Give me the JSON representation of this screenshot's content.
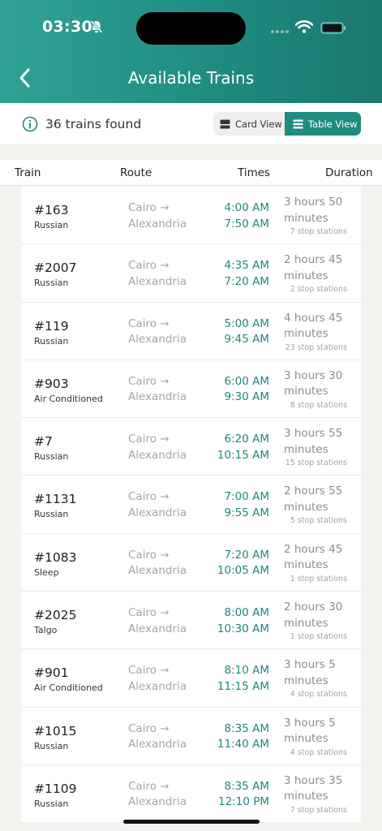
{
  "status_bar": {
    "time": "03:30"
  },
  "header": {
    "title": "Available Trains"
  },
  "summary": {
    "found_text": "36 trains found"
  },
  "view_toggle": {
    "card_label": "Card View",
    "table_label": "Table View",
    "active": "table"
  },
  "table": {
    "headers": {
      "train": "Train",
      "route": "Route",
      "times": "Times",
      "duration": "Duration"
    },
    "rows": [
      {
        "number": "#163",
        "type": "Russian",
        "route_from": "Cairo →",
        "route_to": "Alexandria",
        "depart": "4:00 AM",
        "arrive": "7:50 AM",
        "dur1": "3 hours 50",
        "dur2": "minutes",
        "stops": "7 stop stations"
      },
      {
        "number": "#2007",
        "type": "Russian",
        "route_from": "Cairo →",
        "route_to": "Alexandria",
        "depart": "4:35 AM",
        "arrive": "7:20 AM",
        "dur1": "2 hours 45",
        "dur2": "minutes",
        "stops": "2 stop stations"
      },
      {
        "number": "#119",
        "type": "Russian",
        "route_from": "Cairo →",
        "route_to": "Alexandria",
        "depart": "5:00 AM",
        "arrive": "9:45 AM",
        "dur1": "4 hours 45",
        "dur2": "minutes",
        "stops": "23 stop stations"
      },
      {
        "number": "#903",
        "type": "Air Conditioned",
        "route_from": "Cairo →",
        "route_to": "Alexandria",
        "depart": "6:00 AM",
        "arrive": "9:30 AM",
        "dur1": "3 hours 30",
        "dur2": "minutes",
        "stops": "8 stop stations"
      },
      {
        "number": "#7",
        "type": "Russian",
        "route_from": "Cairo →",
        "route_to": "Alexandria",
        "depart": "6:20 AM",
        "arrive": "10:15 AM",
        "dur1": "3 hours 55",
        "dur2": "minutes",
        "stops": "15 stop stations"
      },
      {
        "number": "#1131",
        "type": "Russian",
        "route_from": "Cairo →",
        "route_to": "Alexandria",
        "depart": "7:00 AM",
        "arrive": "9:55 AM",
        "dur1": "2 hours 55",
        "dur2": "minutes",
        "stops": "5 stop stations"
      },
      {
        "number": "#1083",
        "type": "Sleep",
        "route_from": "Cairo →",
        "route_to": "Alexandria",
        "depart": "7:20 AM",
        "arrive": "10:05 AM",
        "dur1": "2 hours 45",
        "dur2": "minutes",
        "stops": "1 stop stations"
      },
      {
        "number": "#2025",
        "type": "Talgo",
        "route_from": "Cairo →",
        "route_to": "Alexandria",
        "depart": "8:00 AM",
        "arrive": "10:30 AM",
        "dur1": "2 hours 30",
        "dur2": "minutes",
        "stops": "1 stop stations"
      },
      {
        "number": "#901",
        "type": "Air Conditioned",
        "route_from": "Cairo →",
        "route_to": "Alexandria",
        "depart": "8:10 AM",
        "arrive": "11:15 AM",
        "dur1": "3 hours 5",
        "dur2": "minutes",
        "stops": "4 stop stations"
      },
      {
        "number": "#1015",
        "type": "Russian",
        "route_from": "Cairo →",
        "route_to": "Alexandria",
        "depart": "8:35 AM",
        "arrive": "11:40 AM",
        "dur1": "3 hours 5",
        "dur2": "minutes",
        "stops": "4 stop stations"
      },
      {
        "number": "#1109",
        "type": "Russian",
        "route_from": "Cairo →",
        "route_to": "Alexandria",
        "depart": "8:35 AM",
        "arrive": "12:10 PM",
        "dur1": "3 hours 35",
        "dur2": "minutes",
        "stops": "7 stop stations"
      }
    ]
  },
  "colors": {
    "brand": "#1f8c80",
    "time_text": "#1a8a7c",
    "muted": "#a5a5a5"
  },
  "icons": {
    "back": "chevron-left-icon",
    "info": "info-circle-icon",
    "card": "card-view-icon",
    "table": "table-view-icon"
  }
}
